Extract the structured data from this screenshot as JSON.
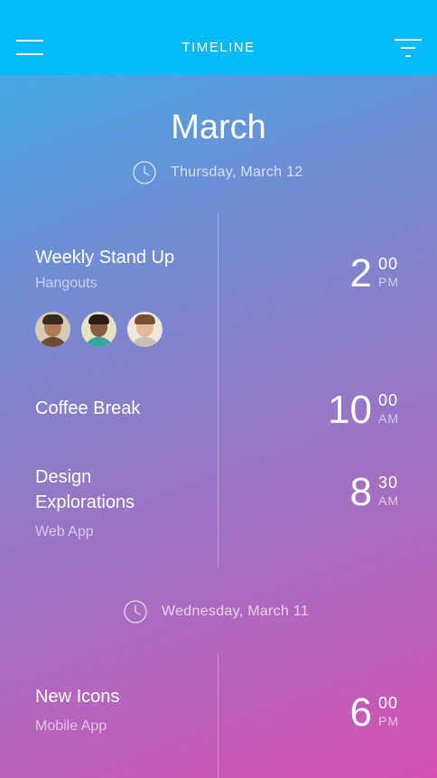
{
  "header": {
    "title": "TIMELINE",
    "menu_icon": "menu-icon",
    "filter_icon": "filter-icon"
  },
  "month": "March",
  "days": [
    {
      "date": "Thursday, March 12",
      "events": [
        {
          "title": "Weekly Stand Up",
          "subtitle": "Hangouts",
          "attendees": [
            "attendee-avatar",
            "attendee-avatar",
            "attendee-avatar"
          ],
          "time": {
            "hour": "2",
            "minutes": "00",
            "period": "PM"
          }
        },
        {
          "title": "Coffee Break",
          "time": {
            "hour": "10",
            "minutes": "00",
            "period": "AM"
          }
        },
        {
          "title_line1": "Design",
          "title_line2": "Explorations",
          "subtitle": "Web App",
          "time": {
            "hour": "8",
            "minutes": "30",
            "period": "AM"
          }
        }
      ]
    },
    {
      "date": "Wednesday, March 11",
      "events": [
        {
          "title": "New Icons",
          "subtitle": "Mobile App",
          "time": {
            "hour": "6",
            "minutes": "00",
            "period": "PM"
          }
        }
      ]
    }
  ],
  "colors": {
    "header_bg": "#03bbf8",
    "gradient_top": "#35b3e8",
    "gradient_bottom": "#d64fb2"
  }
}
